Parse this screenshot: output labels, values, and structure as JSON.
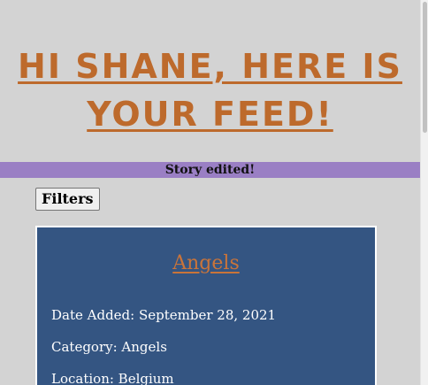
{
  "feed": {
    "heading_line1": "Hi Shane, here is",
    "heading_line2": "your Feed!"
  },
  "alert": {
    "message": "Story edited!"
  },
  "filters": {
    "label": "Filters"
  },
  "story": {
    "title": "Angels",
    "date_label": "Date Added: September 28, 2021",
    "category_label": "Category: Angels",
    "location_label": "Location: Belgium"
  },
  "colors": {
    "background": "#d3d3d3",
    "heading": "#bd6a2c",
    "alert_bar": "#9a7fc4",
    "card": "#345582",
    "card_title": "#c9743a"
  }
}
